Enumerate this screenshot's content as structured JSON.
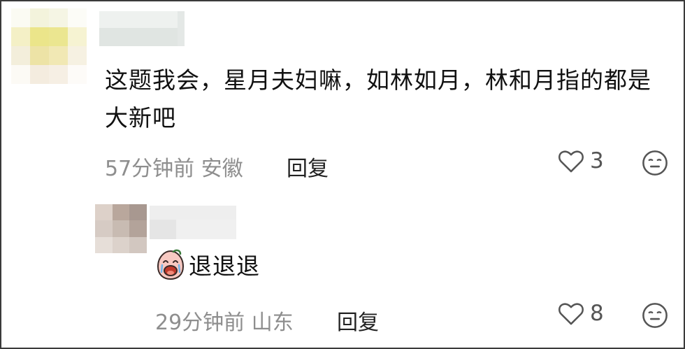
{
  "comment": {
    "text": "这题我会，星月夫妇嘛，如林如月，林和月指的都是大新吧",
    "time": "57分钟前",
    "location": "安徽",
    "reply_label": "回复",
    "likes": "3"
  },
  "reply": {
    "text": "退退退",
    "time": "29分钟前",
    "location": "山东",
    "reply_label": "回复",
    "likes": "8"
  },
  "icons": {
    "like": "heart-outline-icon",
    "dislike": "neutral-face-icon",
    "sticker": "crying-face-sticker-icon"
  }
}
